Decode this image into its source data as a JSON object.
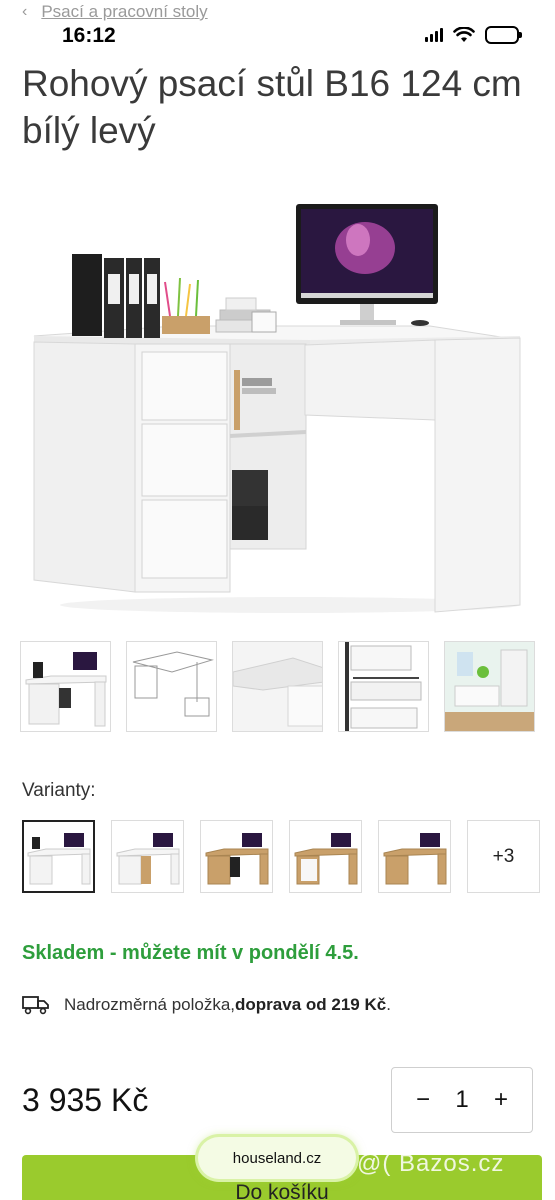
{
  "breadcrumb": {
    "chevron": "‹",
    "label": "Psací a pracovní stoly"
  },
  "status_bar": {
    "time": "16:12",
    "icons": [
      "signal-icon",
      "wifi-icon",
      "battery-icon"
    ]
  },
  "product": {
    "title": "Rohový psací stůl B16 124 cm bílý levý",
    "variants_label": "Varianty:",
    "variants_more": "+3",
    "stock": "Skladem - můžete mít v pondělí 4.5.",
    "shipping_text": "Nadrozměrná položka, ",
    "shipping_bold": "doprava od 219 Kč",
    "shipping_end": ".",
    "price": "3 935 Kč",
    "quantity": "1",
    "qty_minus": "−",
    "qty_plus": "+",
    "cart_label": "Do košíku"
  },
  "overlay": {
    "site": "houseland.cz",
    "watermark": "@( Bazos.cz"
  },
  "colors": {
    "accent_green": "#2e9e3c",
    "cart_green": "#9acb2d",
    "oak": "#c9a06a"
  }
}
